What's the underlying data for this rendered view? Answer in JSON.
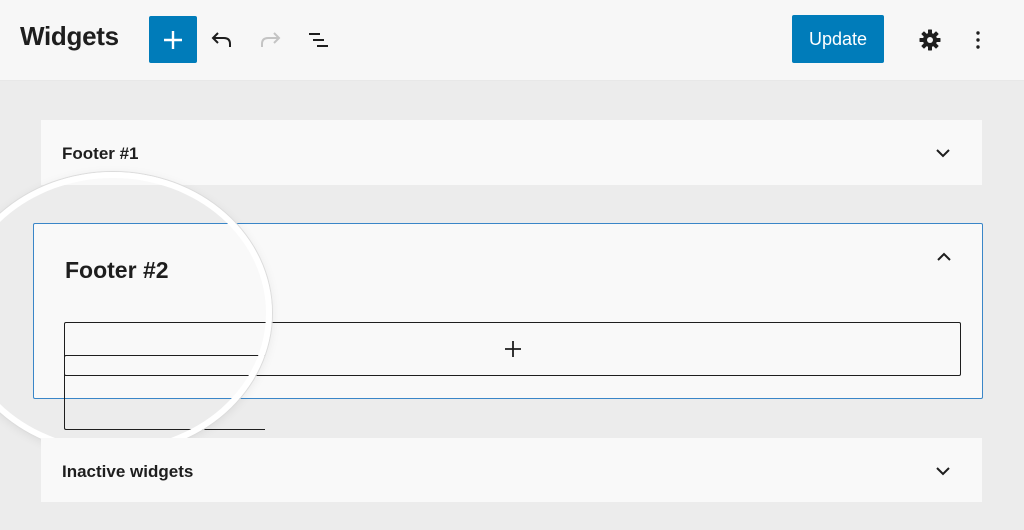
{
  "header": {
    "title": "Widgets",
    "add_block_icon": "plus-icon",
    "undo_icon": "undo-icon",
    "redo_icon": "redo-icon",
    "list_view_icon": "list-view-icon",
    "update_label": "Update",
    "settings_icon": "gear-icon",
    "more_icon": "more-vertical-icon"
  },
  "panels": [
    {
      "title": "Footer #1",
      "expanded": false,
      "toggle_icon": "chevron-down-icon"
    },
    {
      "title": "Footer #2",
      "expanded": true,
      "toggle_icon": "chevron-up-icon",
      "appender_icon": "plus-icon"
    },
    {
      "title": "Inactive widgets",
      "expanded": false,
      "toggle_icon": "chevron-down-icon"
    }
  ],
  "colors": {
    "accent": "#007cba",
    "focus_border": "#3a86c8",
    "canvas_bg": "#ececec",
    "panel_bg": "#f9f9f9"
  }
}
